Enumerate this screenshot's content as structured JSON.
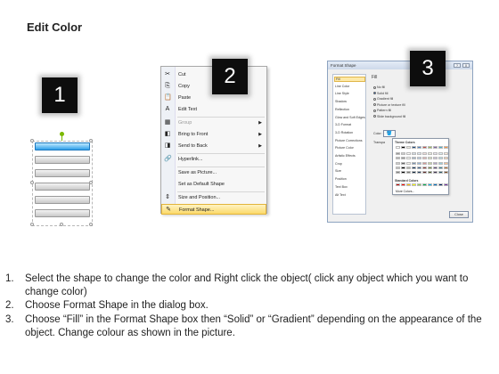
{
  "title": "Edit Color",
  "badges": [
    "1",
    "2",
    "3"
  ],
  "step1": {
    "bar_count": 6,
    "selected_index": 0
  },
  "context_menu": {
    "items": [
      {
        "label": "Cut",
        "icon": "scissors-icon",
        "glyph": "✂"
      },
      {
        "label": "Copy",
        "icon": "copy-icon",
        "glyph": "⎘"
      },
      {
        "label": "Paste",
        "icon": "paste-icon",
        "glyph": "📋"
      },
      {
        "label": "Edit Text",
        "icon": "edit-text-icon",
        "glyph": "A"
      },
      {
        "label": "Group",
        "icon": "group-icon",
        "glyph": "▦",
        "disabled": true,
        "submenu": true
      },
      {
        "label": "Bring to Front",
        "icon": "bring-front-icon",
        "glyph": "◧",
        "submenu": true
      },
      {
        "label": "Send to Back",
        "icon": "send-back-icon",
        "glyph": "◨",
        "submenu": true
      },
      {
        "label": "Hyperlink...",
        "icon": "hyperlink-icon",
        "glyph": "🔗"
      },
      {
        "label": "Save as Picture...",
        "icon": "",
        "glyph": ""
      },
      {
        "label": "Set as Default Shape",
        "icon": "",
        "glyph": ""
      },
      {
        "label": "Size and Position...",
        "icon": "size-icon",
        "glyph": "⇕"
      },
      {
        "label": "Format Shape...",
        "icon": "format-shape-icon",
        "glyph": "✎",
        "highlighted": true
      }
    ]
  },
  "dialog": {
    "title": "Format Shape",
    "window_buttons": [
      "?",
      "X"
    ],
    "nav": [
      "Fill",
      "Line Color",
      "Line Style",
      "Shadow",
      "Reflection",
      "Glow and Soft Edges",
      "3-D Format",
      "3-D Rotation",
      "Picture Corrections",
      "Picture Color",
      "Artistic Effects",
      "Crop",
      "Size",
      "Position",
      "Text Box",
      "Alt Text"
    ],
    "pane_title": "Fill",
    "options": [
      "No fill",
      "Solid fill",
      "Gradient fill",
      "Picture or texture fill",
      "Pattern fill",
      "Slide background fill"
    ],
    "selected_option": 1,
    "color_label": "Color:",
    "transparency_label": "Transpa",
    "palette": {
      "theme_label": "Theme Colors",
      "standard_label": "Standard Colors",
      "more_label": "More Colors...",
      "theme_top": [
        "#ffffff",
        "#000000",
        "#eeece1",
        "#1f497d",
        "#4f81bd",
        "#c0504d",
        "#9bbb59",
        "#8064a2",
        "#4bacc6",
        "#f79646"
      ],
      "standard": [
        "#c00000",
        "#ff0000",
        "#ffc000",
        "#ffff00",
        "#92d050",
        "#00b050",
        "#00b0f0",
        "#0070c0",
        "#002060",
        "#7030a0"
      ]
    },
    "close_label": "Close"
  },
  "instructions": [
    {
      "num": "1.",
      "text": "Select the shape to change the color and Right click the object( click any object which you want to change color)"
    },
    {
      "num": "2.",
      "text": "Choose Format Shape in the dialog box."
    },
    {
      "num": "3.",
      "text": "Choose “Fill” in the Format Shape box then “Solid” or “Gradient” depending on the appearance of the object. Change colour as shown in the picture."
    }
  ]
}
